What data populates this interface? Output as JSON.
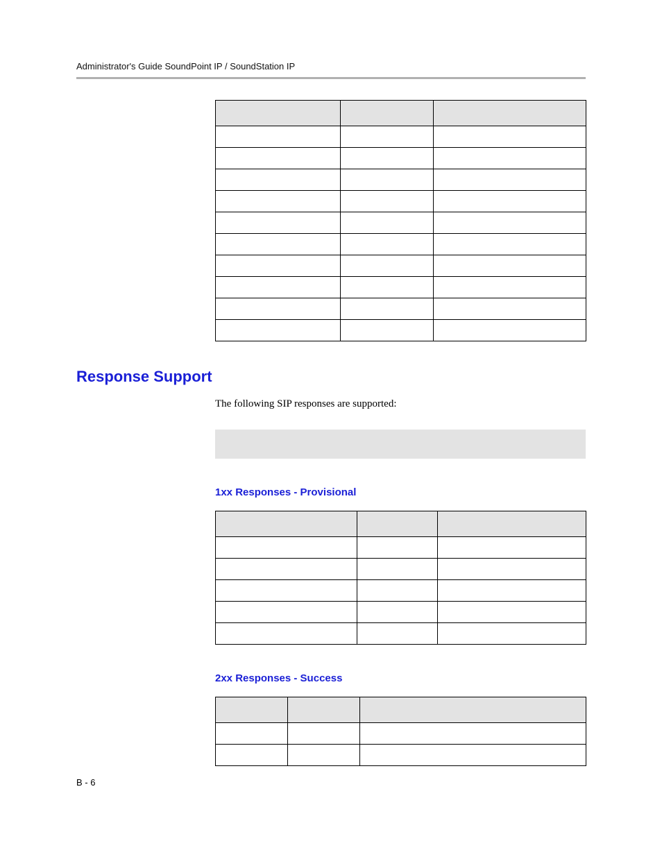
{
  "header": {
    "running_title": "Administrator's Guide SoundPoint IP / SoundStation IP"
  },
  "tables": {
    "headers_table": {
      "head": [
        "",
        "",
        ""
      ],
      "rows": [
        [
          "",
          "",
          ""
        ],
        [
          "",
          "",
          ""
        ],
        [
          "",
          "",
          ""
        ],
        [
          "",
          "",
          ""
        ],
        [
          "",
          "",
          ""
        ],
        [
          "",
          "",
          ""
        ],
        [
          "",
          "",
          ""
        ],
        [
          "",
          "",
          ""
        ],
        [
          "",
          "",
          ""
        ],
        [
          "",
          "",
          ""
        ]
      ]
    },
    "responses_1xx": {
      "head": [
        "",
        "",
        ""
      ],
      "rows": [
        [
          "",
          "",
          ""
        ],
        [
          "",
          "",
          ""
        ],
        [
          "",
          "",
          ""
        ],
        [
          "",
          "",
          ""
        ],
        [
          "",
          "",
          ""
        ]
      ]
    },
    "responses_2xx": {
      "head": [
        "",
        "",
        ""
      ],
      "rows": [
        [
          "",
          "",
          ""
        ],
        [
          "",
          "",
          ""
        ]
      ]
    }
  },
  "sections": {
    "response_support_heading": "Response Support",
    "response_support_intro": "The following SIP responses are supported:",
    "note_placeholder": "",
    "sub_1xx": "1xx Responses - Provisional",
    "sub_2xx": "2xx Responses - Success"
  },
  "footer": {
    "page_number": "B - 6"
  }
}
